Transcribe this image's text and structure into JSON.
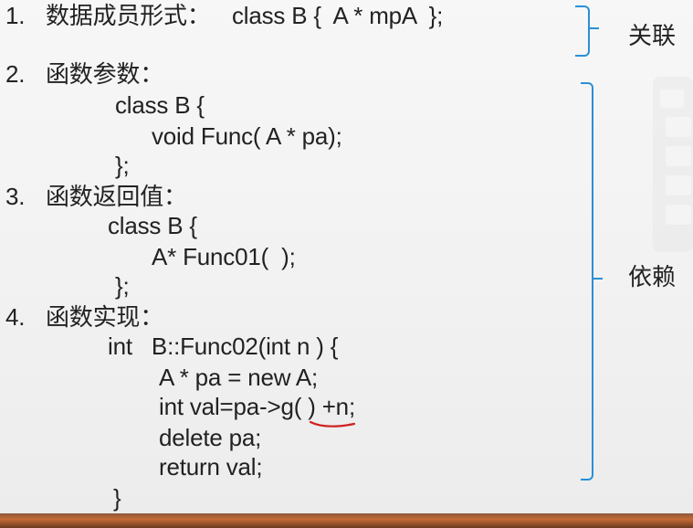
{
  "items": [
    {
      "number": "1.",
      "heading": "数据成员形式：",
      "code": "class B {  A * mpA  };"
    },
    {
      "number": "2.",
      "heading": "函数参数："
    },
    {
      "number": "3.",
      "heading": "函数返回值："
    },
    {
      "number": "4.",
      "heading": "函数实现："
    }
  ],
  "code_blocks": {
    "params": [
      "class B {",
      "void Func( A * pa);",
      "};"
    ],
    "return_value": [
      "class B {",
      "A* Func01(  );",
      "};"
    ],
    "impl": [
      "int   B::Func02(int n ) {",
      "A * pa = new A;",
      "int val=pa->",
      "g( )",
      " +n;",
      "delete pa;",
      "return val;",
      "}"
    ]
  },
  "labels": {
    "association": "关联",
    "dependency": "依赖"
  },
  "colors": {
    "bracket": "#2b8fd6",
    "underline": "#d11f1f"
  }
}
